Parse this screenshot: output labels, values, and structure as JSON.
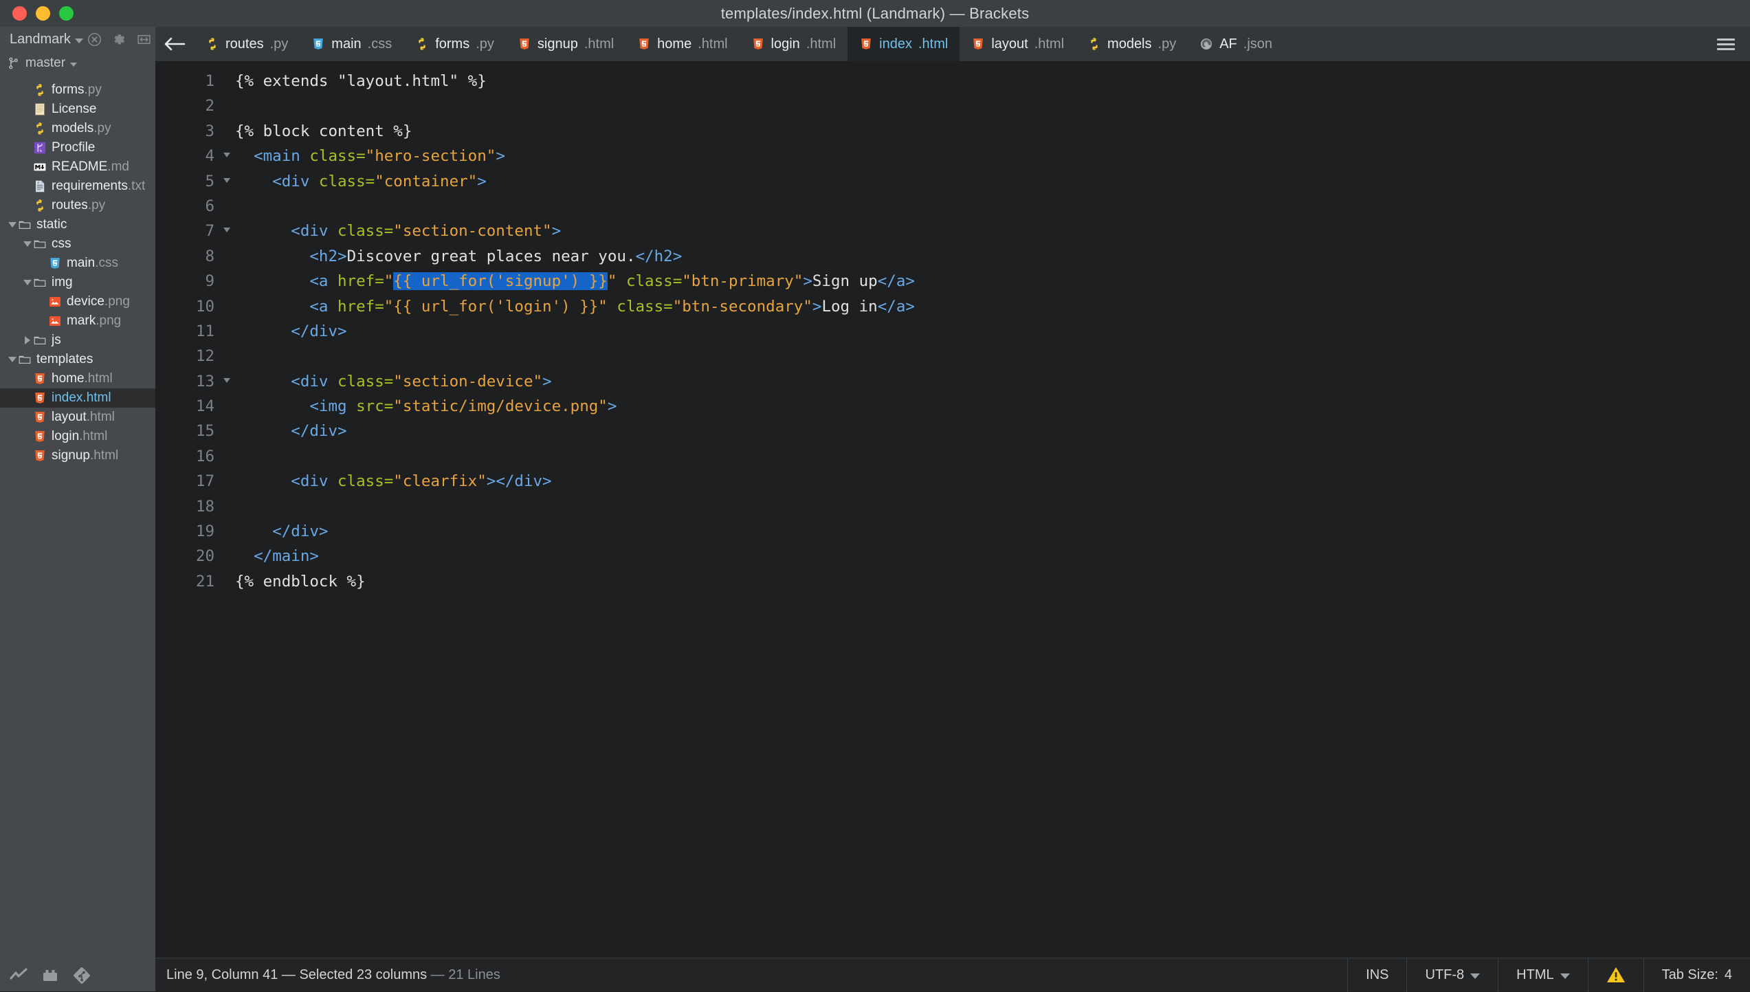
{
  "window": {
    "title": "templates/index.html (Landmark) — Brackets",
    "controls": [
      "close",
      "minimize",
      "maximize"
    ]
  },
  "sidebar": {
    "project_name": "Landmark",
    "branch": "master",
    "header_icons": [
      "close-circle-icon",
      "gear-icon",
      "split-view-icon"
    ],
    "footer_icons": [
      "live-preview-icon",
      "extension-manager-icon",
      "git-icon"
    ],
    "tree": [
      {
        "name": "forms.py",
        "base": "forms",
        "ext": ".py",
        "icon": "python-file-icon",
        "indent": 1,
        "type": "file"
      },
      {
        "name": "License",
        "base": "License",
        "ext": "",
        "icon": "license-file-icon",
        "indent": 1,
        "type": "file"
      },
      {
        "name": "models.py",
        "base": "models",
        "ext": ".py",
        "icon": "python-file-icon",
        "indent": 1,
        "type": "file"
      },
      {
        "name": "Procfile",
        "base": "Procfile",
        "ext": "",
        "icon": "heroku-file-icon",
        "indent": 1,
        "type": "file"
      },
      {
        "name": "README.md",
        "base": "README",
        "ext": ".md",
        "icon": "markdown-file-icon",
        "indent": 1,
        "type": "file"
      },
      {
        "name": "requirements.txt",
        "base": "requirements",
        "ext": ".txt",
        "icon": "text-file-icon",
        "indent": 1,
        "type": "file"
      },
      {
        "name": "routes.py",
        "base": "routes",
        "ext": ".py",
        "icon": "python-file-icon",
        "indent": 1,
        "type": "file"
      },
      {
        "name": "static",
        "base": "static",
        "ext": "",
        "icon": "folder-icon",
        "indent": 0,
        "type": "folder",
        "state": "open"
      },
      {
        "name": "css",
        "base": "css",
        "ext": "",
        "icon": "folder-icon",
        "indent": 1,
        "type": "folder",
        "state": "open"
      },
      {
        "name": "main.css",
        "base": "main",
        "ext": ".css",
        "icon": "css-file-icon",
        "indent": 2,
        "type": "file"
      },
      {
        "name": "img",
        "base": "img",
        "ext": "",
        "icon": "folder-icon",
        "indent": 1,
        "type": "folder",
        "state": "open"
      },
      {
        "name": "device.png",
        "base": "device",
        "ext": ".png",
        "icon": "image-file-icon",
        "indent": 2,
        "type": "file"
      },
      {
        "name": "mark.png",
        "base": "mark",
        "ext": ".png",
        "icon": "image-file-icon",
        "indent": 2,
        "type": "file"
      },
      {
        "name": "js",
        "base": "js",
        "ext": "",
        "icon": "folder-icon",
        "indent": 1,
        "type": "folder",
        "state": "closed"
      },
      {
        "name": "templates",
        "base": "templates",
        "ext": "",
        "icon": "folder-icon",
        "indent": 0,
        "type": "folder",
        "state": "open"
      },
      {
        "name": "home.html",
        "base": "home",
        "ext": ".html",
        "icon": "html-file-icon",
        "indent": 1,
        "type": "file"
      },
      {
        "name": "index.html",
        "base": "index",
        "ext": ".html",
        "icon": "html-file-icon",
        "indent": 1,
        "type": "file",
        "selected": true
      },
      {
        "name": "layout.html",
        "base": "layout",
        "ext": ".html",
        "icon": "html-file-icon",
        "indent": 1,
        "type": "file"
      },
      {
        "name": "login.html",
        "base": "login",
        "ext": ".html",
        "icon": "html-file-icon",
        "indent": 1,
        "type": "file"
      },
      {
        "name": "signup.html",
        "base": "signup",
        "ext": ".html",
        "icon": "html-file-icon",
        "indent": 1,
        "type": "file"
      }
    ]
  },
  "tabbar": {
    "back_label": "←",
    "menu_icon": "hamburger-menu-icon",
    "tabs": [
      {
        "name": "routes.py",
        "base": "routes",
        "ext": ".py",
        "icon": "python-file-icon",
        "active": false
      },
      {
        "name": "main.css",
        "base": "main",
        "ext": ".css",
        "icon": "css-file-icon",
        "active": false
      },
      {
        "name": "forms.py",
        "base": "forms",
        "ext": ".py",
        "icon": "python-file-icon",
        "active": false
      },
      {
        "name": "signup.html",
        "base": "signup",
        "ext": ".html",
        "icon": "html-file-icon",
        "active": false
      },
      {
        "name": "home.html",
        "base": "home",
        "ext": ".html",
        "icon": "html-file-icon",
        "active": false
      },
      {
        "name": "login.html",
        "base": "login",
        "ext": ".html",
        "icon": "html-file-icon",
        "active": false
      },
      {
        "name": "index.html",
        "base": "index",
        "ext": ".html",
        "icon": "html-file-icon",
        "active": true
      },
      {
        "name": "layout.html",
        "base": "layout",
        "ext": ".html",
        "icon": "html-file-icon",
        "active": false
      },
      {
        "name": "models.py",
        "base": "models",
        "ext": ".py",
        "icon": "python-file-icon",
        "active": false
      },
      {
        "name": "AF.json",
        "base": "AF",
        "ext": ".json",
        "icon": "json-file-icon",
        "active": false
      }
    ]
  },
  "editor": {
    "language": "HTML",
    "lines": [
      {
        "n": 1,
        "fold": false,
        "tokens": [
          {
            "t": "plain",
            "v": "{% extends \"layout.html\" %}"
          }
        ]
      },
      {
        "n": 2,
        "fold": false,
        "tokens": []
      },
      {
        "n": 3,
        "fold": false,
        "tokens": [
          {
            "t": "plain",
            "v": "{% block content %}"
          }
        ]
      },
      {
        "n": 4,
        "fold": true,
        "tokens": [
          {
            "t": "plain",
            "v": "  "
          },
          {
            "t": "punc",
            "v": "<"
          },
          {
            "t": "tag",
            "v": "main"
          },
          {
            "t": "plain",
            "v": " "
          },
          {
            "t": "attr",
            "v": "class"
          },
          {
            "t": "attr",
            "v": "="
          },
          {
            "t": "str",
            "v": "\"hero-section\""
          },
          {
            "t": "punc",
            "v": ">"
          }
        ]
      },
      {
        "n": 5,
        "fold": true,
        "tokens": [
          {
            "t": "plain",
            "v": "    "
          },
          {
            "t": "punc",
            "v": "<"
          },
          {
            "t": "tag",
            "v": "div"
          },
          {
            "t": "plain",
            "v": " "
          },
          {
            "t": "attr",
            "v": "class"
          },
          {
            "t": "attr",
            "v": "="
          },
          {
            "t": "str",
            "v": "\"container\""
          },
          {
            "t": "punc",
            "v": ">"
          }
        ]
      },
      {
        "n": 6,
        "fold": false,
        "tokens": []
      },
      {
        "n": 7,
        "fold": true,
        "tokens": [
          {
            "t": "plain",
            "v": "      "
          },
          {
            "t": "punc",
            "v": "<"
          },
          {
            "t": "tag",
            "v": "div"
          },
          {
            "t": "plain",
            "v": " "
          },
          {
            "t": "attr",
            "v": "class"
          },
          {
            "t": "attr",
            "v": "="
          },
          {
            "t": "str",
            "v": "\"section-content\""
          },
          {
            "t": "punc",
            "v": ">"
          }
        ]
      },
      {
        "n": 8,
        "fold": false,
        "tokens": [
          {
            "t": "plain",
            "v": "        "
          },
          {
            "t": "punc",
            "v": "<"
          },
          {
            "t": "tag",
            "v": "h2"
          },
          {
            "t": "punc",
            "v": ">"
          },
          {
            "t": "plain",
            "v": "Discover great places near you."
          },
          {
            "t": "punc",
            "v": "</"
          },
          {
            "t": "tag",
            "v": "h2"
          },
          {
            "t": "punc",
            "v": ">"
          }
        ]
      },
      {
        "n": 9,
        "fold": false,
        "tokens": [
          {
            "t": "plain",
            "v": "        "
          },
          {
            "t": "punc",
            "v": "<"
          },
          {
            "t": "tag",
            "v": "a"
          },
          {
            "t": "plain",
            "v": " "
          },
          {
            "t": "attr",
            "v": "href"
          },
          {
            "t": "attr",
            "v": "="
          },
          {
            "t": "str",
            "v": "\""
          },
          {
            "t": "sel",
            "v": "{{ url_for('signup') }}"
          },
          {
            "t": "str",
            "v": "\""
          },
          {
            "t": "plain",
            "v": " "
          },
          {
            "t": "attr",
            "v": "class"
          },
          {
            "t": "attr",
            "v": "="
          },
          {
            "t": "str",
            "v": "\"btn-primary\""
          },
          {
            "t": "punc",
            "v": ">"
          },
          {
            "t": "plain",
            "v": "Sign up"
          },
          {
            "t": "punc",
            "v": "</"
          },
          {
            "t": "tag",
            "v": "a"
          },
          {
            "t": "punc",
            "v": ">"
          }
        ]
      },
      {
        "n": 10,
        "fold": false,
        "tokens": [
          {
            "t": "plain",
            "v": "        "
          },
          {
            "t": "punc",
            "v": "<"
          },
          {
            "t": "tag",
            "v": "a"
          },
          {
            "t": "plain",
            "v": " "
          },
          {
            "t": "attr",
            "v": "href"
          },
          {
            "t": "attr",
            "v": "="
          },
          {
            "t": "str",
            "v": "\"{{ url_for('login') }}\""
          },
          {
            "t": "plain",
            "v": " "
          },
          {
            "t": "attr",
            "v": "class"
          },
          {
            "t": "attr",
            "v": "="
          },
          {
            "t": "str",
            "v": "\"btn-secondary\""
          },
          {
            "t": "punc",
            "v": ">"
          },
          {
            "t": "plain",
            "v": "Log in"
          },
          {
            "t": "punc",
            "v": "</"
          },
          {
            "t": "tag",
            "v": "a"
          },
          {
            "t": "punc",
            "v": ">"
          }
        ]
      },
      {
        "n": 11,
        "fold": false,
        "tokens": [
          {
            "t": "plain",
            "v": "      "
          },
          {
            "t": "punc",
            "v": "</"
          },
          {
            "t": "tag",
            "v": "div"
          },
          {
            "t": "punc",
            "v": ">"
          }
        ]
      },
      {
        "n": 12,
        "fold": false,
        "tokens": []
      },
      {
        "n": 13,
        "fold": true,
        "tokens": [
          {
            "t": "plain",
            "v": "      "
          },
          {
            "t": "punc",
            "v": "<"
          },
          {
            "t": "tag",
            "v": "div"
          },
          {
            "t": "plain",
            "v": " "
          },
          {
            "t": "attr",
            "v": "class"
          },
          {
            "t": "attr",
            "v": "="
          },
          {
            "t": "str",
            "v": "\"section-device\""
          },
          {
            "t": "punc",
            "v": ">"
          }
        ]
      },
      {
        "n": 14,
        "fold": false,
        "tokens": [
          {
            "t": "plain",
            "v": "        "
          },
          {
            "t": "punc",
            "v": "<"
          },
          {
            "t": "tag",
            "v": "img"
          },
          {
            "t": "plain",
            "v": " "
          },
          {
            "t": "attr",
            "v": "src"
          },
          {
            "t": "attr",
            "v": "="
          },
          {
            "t": "str",
            "v": "\"static/img/device.png\""
          },
          {
            "t": "punc",
            "v": ">"
          }
        ]
      },
      {
        "n": 15,
        "fold": false,
        "tokens": [
          {
            "t": "plain",
            "v": "      "
          },
          {
            "t": "punc",
            "v": "</"
          },
          {
            "t": "tag",
            "v": "div"
          },
          {
            "t": "punc",
            "v": ">"
          }
        ]
      },
      {
        "n": 16,
        "fold": false,
        "tokens": []
      },
      {
        "n": 17,
        "fold": false,
        "tokens": [
          {
            "t": "plain",
            "v": "      "
          },
          {
            "t": "punc",
            "v": "<"
          },
          {
            "t": "tag",
            "v": "div"
          },
          {
            "t": "plain",
            "v": " "
          },
          {
            "t": "attr",
            "v": "class"
          },
          {
            "t": "attr",
            "v": "="
          },
          {
            "t": "str",
            "v": "\"clearfix\""
          },
          {
            "t": "punc",
            "v": ">"
          },
          {
            "t": "punc",
            "v": "</"
          },
          {
            "t": "tag",
            "v": "div"
          },
          {
            "t": "punc",
            "v": ">"
          }
        ]
      },
      {
        "n": 18,
        "fold": false,
        "tokens": []
      },
      {
        "n": 19,
        "fold": false,
        "tokens": [
          {
            "t": "plain",
            "v": "    "
          },
          {
            "t": "punc",
            "v": "</"
          },
          {
            "t": "tag",
            "v": "div"
          },
          {
            "t": "punc",
            "v": ">"
          }
        ]
      },
      {
        "n": 20,
        "fold": false,
        "tokens": [
          {
            "t": "plain",
            "v": "  "
          },
          {
            "t": "punc",
            "v": "</"
          },
          {
            "t": "tag",
            "v": "main"
          },
          {
            "t": "punc",
            "v": ">"
          }
        ]
      },
      {
        "n": 21,
        "fold": false,
        "tokens": [
          {
            "t": "plain",
            "v": "{% endblock %}"
          }
        ]
      }
    ]
  },
  "statusbar": {
    "cursor_text": "Line 9, Column 41 — Selected 23 columns",
    "lines_text": "21 Lines",
    "insert_mode": "INS",
    "encoding": "UTF-8",
    "language": "HTML",
    "warning_icon": "warning-triangle-icon",
    "tab_size_label": "Tab Size:",
    "tab_size_value": "4"
  },
  "colors": {
    "titlebar_bg": "#3b4043",
    "sidebar_bg": "#45494e",
    "tabbar_bg": "#33373a",
    "editor_bg": "#1d1f21",
    "statusbar_bg": "#222426",
    "accent_blue": "#6fc1ee",
    "selection_blue": "#1565c8",
    "tag_color": "#6aa9e8",
    "attr_color": "#a8c023",
    "string_color": "#e8a33d",
    "warning_yellow": "#f5c518"
  }
}
